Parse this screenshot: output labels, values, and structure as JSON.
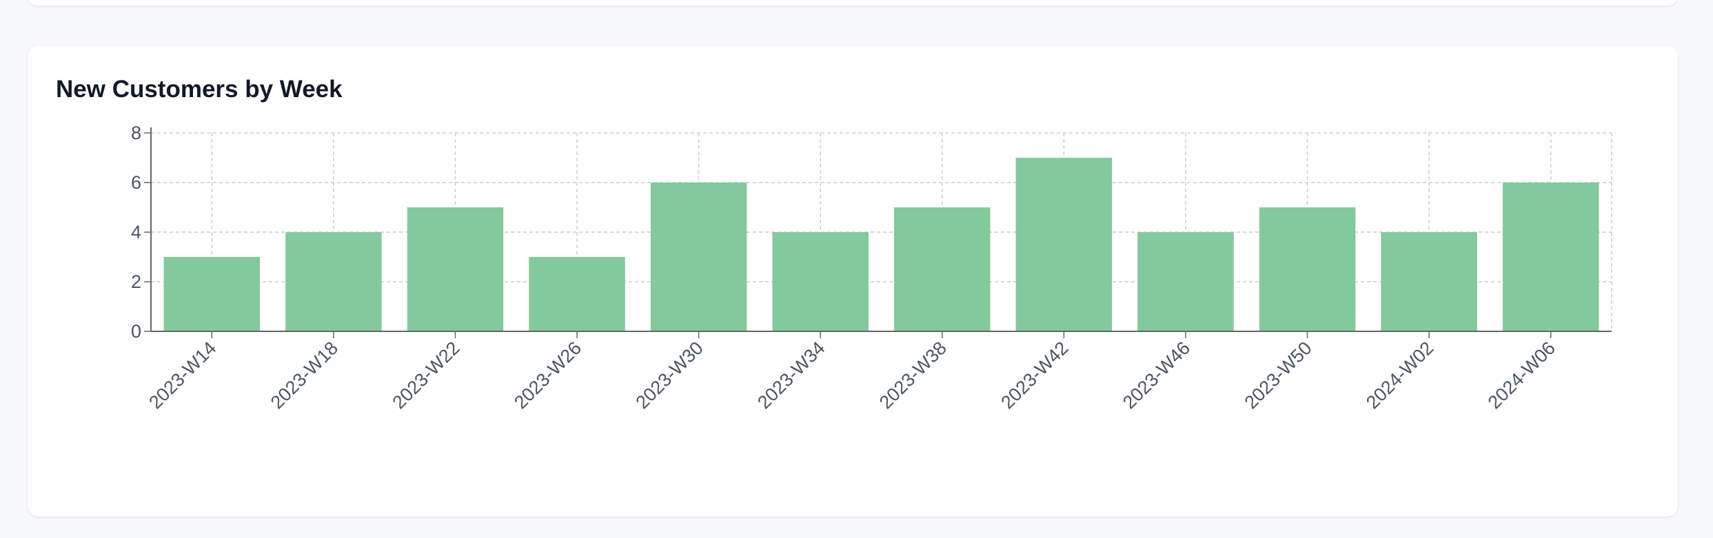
{
  "colors": {
    "page_background": "#f8f9fb",
    "card_background": "#ffffff",
    "bar_fill": "#84c99c",
    "grid": "#cccccc",
    "axis": "#666666",
    "title": "#111827",
    "tick_text": "#4b5563"
  },
  "chart_data": {
    "type": "bar",
    "title": "New Customers by Week",
    "xlabel": "",
    "ylabel": "",
    "categories": [
      "2023-W14",
      "2023-W18",
      "2023-W22",
      "2023-W26",
      "2023-W30",
      "2023-W34",
      "2023-W38",
      "2023-W42",
      "2023-W46",
      "2023-W50",
      "2024-W02",
      "2024-W06"
    ],
    "values": [
      3,
      4,
      5,
      3,
      6,
      4,
      5,
      7,
      4,
      5,
      4,
      6
    ],
    "ylim": [
      0,
      8
    ],
    "yticks": [
      0,
      2,
      4,
      6,
      8
    ],
    "grid": true,
    "legend": "none"
  }
}
